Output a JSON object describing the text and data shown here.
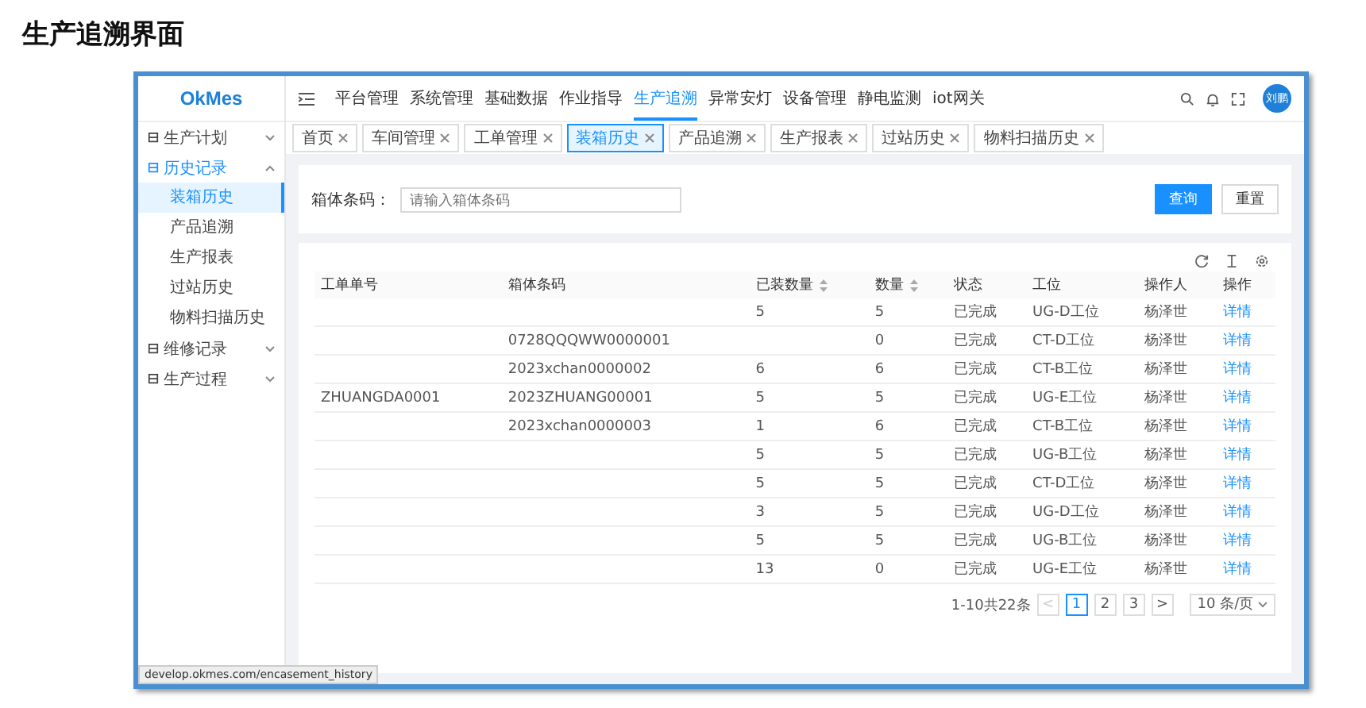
{
  "page_title": "生产追溯界面",
  "app": {
    "logo": "OkMes",
    "avatar": "刘鹏",
    "nav": [
      {
        "label": "平台管理",
        "selected": false
      },
      {
        "label": "系统管理",
        "selected": false
      },
      {
        "label": "基础数据",
        "selected": false
      },
      {
        "label": "作业指导",
        "selected": false
      },
      {
        "label": "生产追溯",
        "selected": true
      },
      {
        "label": "异常安灯",
        "selected": false
      },
      {
        "label": "设备管理",
        "selected": false
      },
      {
        "label": "静电监测",
        "selected": false
      },
      {
        "label": "iot网关",
        "selected": false
      }
    ],
    "sidebar": [
      {
        "label": "生产计划",
        "expanded": false,
        "selected": false
      },
      {
        "label": "历史记录",
        "expanded": true,
        "selected": true,
        "children": [
          {
            "label": "装箱历史",
            "selected": true
          },
          {
            "label": "产品追溯",
            "selected": false
          },
          {
            "label": "生产报表",
            "selected": false
          },
          {
            "label": "过站历史",
            "selected": false
          },
          {
            "label": "物料扫描历史",
            "selected": false
          }
        ]
      },
      {
        "label": "维修记录",
        "expanded": false,
        "selected": false
      },
      {
        "label": "生产过程",
        "expanded": false,
        "selected": false
      }
    ],
    "tabs": [
      {
        "label": "首页",
        "selected": false
      },
      {
        "label": "车间管理",
        "selected": false
      },
      {
        "label": "工单管理",
        "selected": false
      },
      {
        "label": "装箱历史",
        "selected": true
      },
      {
        "label": "产品追溯",
        "selected": false
      },
      {
        "label": "生产报表",
        "selected": false
      },
      {
        "label": "过站历史",
        "selected": false
      },
      {
        "label": "物料扫描历史",
        "selected": false
      }
    ],
    "search": {
      "label": "箱体条码：",
      "placeholder": "请输入箱体条码",
      "buttons": [
        "查询",
        "重置"
      ]
    },
    "table": {
      "columns": [
        {
          "label": "工单单号",
          "sortable": false
        },
        {
          "label": "箱体条码",
          "sortable": false
        },
        {
          "label": "已装数量",
          "sortable": true
        },
        {
          "label": "数量",
          "sortable": true
        },
        {
          "label": "状态",
          "sortable": false
        },
        {
          "label": "工位",
          "sortable": false
        },
        {
          "label": "操作人",
          "sortable": false
        },
        {
          "label": "操作",
          "sortable": false
        }
      ],
      "rows": [
        [
          "",
          "",
          "5",
          "5",
          "已完成",
          "UG-D工位",
          "杨泽世",
          "详情"
        ],
        [
          "",
          "0728QQQWW0000001",
          "",
          "0",
          "已完成",
          "CT-D工位",
          "杨泽世",
          "详情"
        ],
        [
          "",
          "2023xchan0000002",
          "6",
          "6",
          "已完成",
          "CT-B工位",
          "杨泽世",
          "详情"
        ],
        [
          "ZHUANGDA0001",
          "2023ZHUANG00001",
          "5",
          "5",
          "已完成",
          "UG-E工位",
          "杨泽世",
          "详情"
        ],
        [
          "",
          "2023xchan0000003",
          "1",
          "6",
          "已完成",
          "CT-B工位",
          "杨泽世",
          "详情"
        ],
        [
          "",
          "",
          "5",
          "5",
          "已完成",
          "UG-B工位",
          "杨泽世",
          "详情"
        ],
        [
          "",
          "",
          "5",
          "5",
          "已完成",
          "CT-D工位",
          "杨泽世",
          "详情"
        ],
        [
          "",
          "",
          "3",
          "5",
          "已完成",
          "UG-D工位",
          "杨泽世",
          "详情"
        ],
        [
          "",
          "",
          "5",
          "5",
          "已完成",
          "UG-B工位",
          "杨泽世",
          "详情"
        ],
        [
          "",
          "",
          "13",
          "0",
          "已完成",
          "UG-E工位",
          "杨泽世",
          "详情"
        ]
      ]
    },
    "pagination": {
      "summary": "1-10共22条",
      "prev": "<",
      "next": ">",
      "pages": [
        {
          "label": "1",
          "selected": true
        },
        {
          "label": "2",
          "selected": false
        },
        {
          "label": "3",
          "selected": false
        }
      ],
      "page_size": "10 条/页"
    },
    "status_url": "develop.okmes.com/encasement_history"
  }
}
